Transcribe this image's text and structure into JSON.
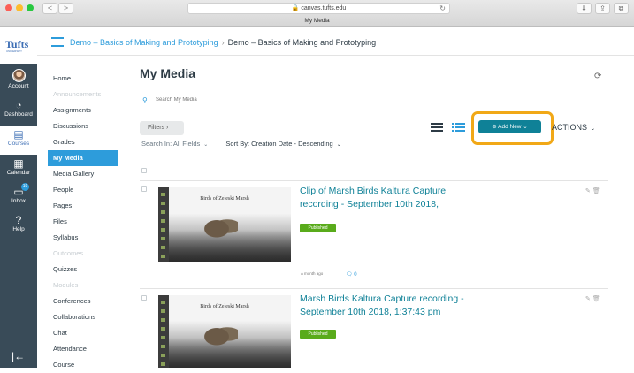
{
  "browser": {
    "url": "canvas.tufts.edu",
    "tab_title": "My Media",
    "back_icon": "<",
    "forward_icon": ">",
    "reload_icon": "↻"
  },
  "global_nav": {
    "logo": "Tufts",
    "logo_sub": "UNIVERSITY",
    "items": [
      {
        "label": "Account",
        "icon": "avatar"
      },
      {
        "label": "Dashboard",
        "icon": "dashboard-icon"
      },
      {
        "label": "Courses",
        "icon": "book-icon",
        "active": true
      },
      {
        "label": "Calendar",
        "icon": "calendar-icon"
      },
      {
        "label": "Inbox",
        "icon": "inbox-icon",
        "badge": "19"
      },
      {
        "label": "Help",
        "icon": "help-icon"
      }
    ],
    "collapse_icon": "|←"
  },
  "breadcrumb": {
    "course": "Demo – Basics of Making and Prototyping",
    "current": "Demo – Basics of Making and Prototyping"
  },
  "course_nav": [
    {
      "label": "Home",
      "state": "normal"
    },
    {
      "label": "Announcements",
      "state": "disabled"
    },
    {
      "label": "Assignments",
      "state": "normal"
    },
    {
      "label": "Discussions",
      "state": "normal"
    },
    {
      "label": "Grades",
      "state": "normal"
    },
    {
      "label": "My Media",
      "state": "active"
    },
    {
      "label": "Media Gallery",
      "state": "normal"
    },
    {
      "label": "People",
      "state": "normal"
    },
    {
      "label": "Pages",
      "state": "normal"
    },
    {
      "label": "Files",
      "state": "normal"
    },
    {
      "label": "Syllabus",
      "state": "normal"
    },
    {
      "label": "Outcomes",
      "state": "disabled"
    },
    {
      "label": "Quizzes",
      "state": "normal"
    },
    {
      "label": "Modules",
      "state": "disabled"
    },
    {
      "label": "Conferences",
      "state": "normal"
    },
    {
      "label": "Collaborations",
      "state": "normal"
    },
    {
      "label": "Chat",
      "state": "normal"
    },
    {
      "label": "Attendance",
      "state": "normal"
    },
    {
      "label": "Course",
      "state": "normal"
    }
  ],
  "main": {
    "title": "My Media",
    "search_placeholder": "Search My Media",
    "filters_label": "Filters",
    "search_in": "Search In: All Fields",
    "sort_by": "Sort By: Creation Date - Descending",
    "add_new_label": "Add New",
    "actions_label": "ACTIONS",
    "media": [
      {
        "title": "Clip of Marsh Birds Kaltura Capture recording - September 10th 2018,",
        "status": "Published",
        "thumb_caption": "Birds of Zeleski Marsh",
        "age": "A month ago",
        "comments": "0"
      },
      {
        "title": "Marsh Birds Kaltura Capture recording - September 10th 2018, 1:37:43 pm",
        "status": "Published",
        "thumb_caption": "Birds of Zeleski Marsh"
      }
    ]
  },
  "colors": {
    "nav_bg": "#394b58",
    "link": "#2d9cdb",
    "add_new": "#0f8197",
    "highlight": "#f1a817",
    "published": "#59ab1b"
  }
}
